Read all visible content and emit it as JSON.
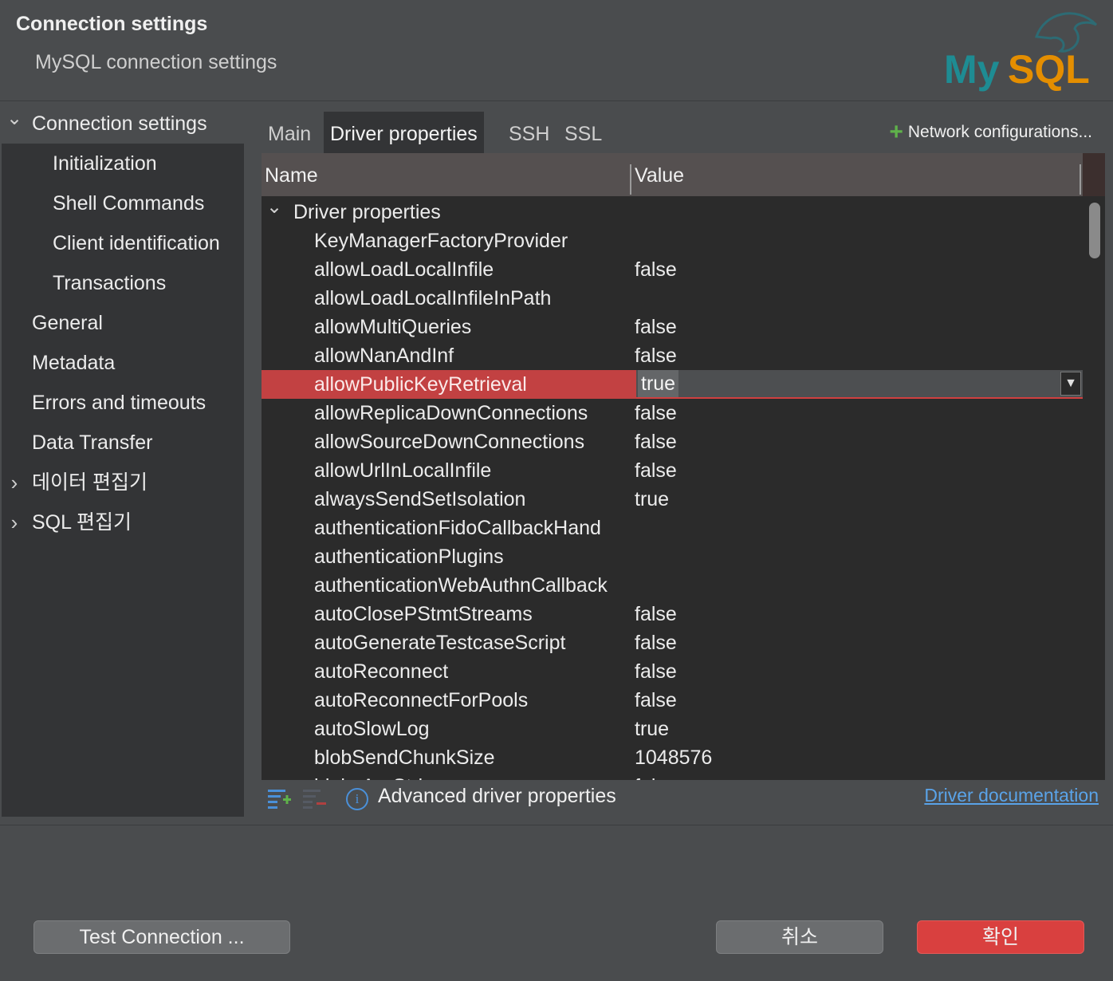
{
  "header": {
    "title": "Connection settings",
    "subtitle": "MySQL connection settings",
    "logo_text": "MySQL"
  },
  "sidebar": {
    "items": [
      {
        "label": "Connection settings",
        "expander": "expanded",
        "selected": true
      },
      {
        "label": "Initialization"
      },
      {
        "label": "Shell Commands"
      },
      {
        "label": "Client identification"
      },
      {
        "label": "Transactions"
      },
      {
        "label": "General"
      },
      {
        "label": "Metadata"
      },
      {
        "label": "Errors and timeouts"
      },
      {
        "label": "Data Transfer"
      },
      {
        "label": "데이터 편집기",
        "expander": "collapsed"
      },
      {
        "label": "SQL 편집기",
        "expander": "collapsed"
      }
    ]
  },
  "tabs": [
    {
      "label": "Main"
    },
    {
      "label": "Driver properties",
      "active": true
    },
    {
      "label": "SSH"
    },
    {
      "label": "SSL"
    }
  ],
  "network_config": {
    "label": "Network configurations..."
  },
  "table": {
    "columns": [
      "Name",
      "Value"
    ],
    "group": "Driver properties",
    "rows": [
      {
        "name": "KeyManagerFactoryProvider",
        "value": ""
      },
      {
        "name": "allowLoadLocalInfile",
        "value": "false"
      },
      {
        "name": "allowLoadLocalInfileInPath",
        "value": ""
      },
      {
        "name": "allowMultiQueries",
        "value": "false"
      },
      {
        "name": "allowNanAndInf",
        "value": "false"
      },
      {
        "name": "allowPublicKeyRetrieval",
        "value": "true",
        "selected": true
      },
      {
        "name": "allowReplicaDownConnections",
        "value": "false"
      },
      {
        "name": "allowSourceDownConnections",
        "value": "false"
      },
      {
        "name": "allowUrlInLocalInfile",
        "value": "false"
      },
      {
        "name": "alwaysSendSetIsolation",
        "value": "true"
      },
      {
        "name": "authenticationFidoCallbackHand",
        "value": ""
      },
      {
        "name": "authenticationPlugins",
        "value": ""
      },
      {
        "name": "authenticationWebAuthnCallback",
        "value": ""
      },
      {
        "name": "autoClosePStmtStreams",
        "value": "false"
      },
      {
        "name": "autoGenerateTestcaseScript",
        "value": "false"
      },
      {
        "name": "autoReconnect",
        "value": "false"
      },
      {
        "name": "autoReconnectForPools",
        "value": "false"
      },
      {
        "name": "autoSlowLog",
        "value": "true"
      },
      {
        "name": "blobSendChunkSize",
        "value": "1048576"
      },
      {
        "name": "blobsAreStrings",
        "value": "false"
      }
    ]
  },
  "footer": {
    "advanced_label": "Advanced driver properties",
    "doc_link": "Driver documentation"
  },
  "buttons": {
    "test": "Test Connection ...",
    "cancel": "취소",
    "ok": "확인"
  },
  "colors": {
    "accent_red": "#d9403f",
    "selection_red": "#c24142",
    "link_blue": "#5aa3e8",
    "logo_teal": "#1e8c93",
    "logo_orange": "#e48e00",
    "add_green": "#5fb24a"
  }
}
